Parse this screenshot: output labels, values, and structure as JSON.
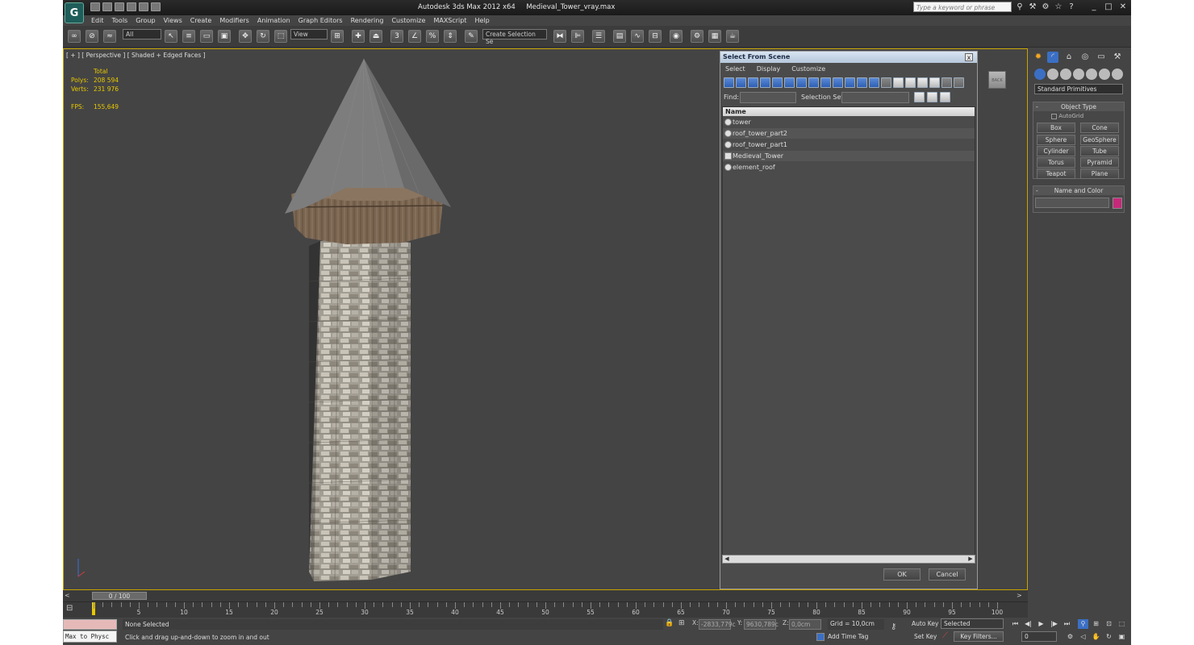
{
  "title_bar": {
    "app_title": "Autodesk 3ds Max  2012 x64",
    "file_name": "Medieval_Tower_vray.max",
    "search_placeholder": "Type a keyword or phrase"
  },
  "menu": [
    "Edit",
    "Tools",
    "Group",
    "Views",
    "Create",
    "Modifiers",
    "Animation",
    "Graph Editors",
    "Rendering",
    "Customize",
    "MAXScript",
    "Help"
  ],
  "toolbar": {
    "selection_filter": "All",
    "reference_coord": "View",
    "named_selection_set": "Create Selection Se",
    "snap_labels": [
      "3",
      "%"
    ]
  },
  "viewport": {
    "label": "[ + ] [ Perspective ] [ Shaded + Edged Faces ]",
    "stats_header": "Total",
    "polys_label": "Polys:",
    "polys_value": "208 594",
    "verts_label": "Verts:",
    "verts_value": "231 976",
    "fps_label": "FPS:",
    "fps_value": "155,649",
    "viewcube_label": "BACK"
  },
  "dialog": {
    "title": "Select From Scene",
    "close": "x",
    "menu": [
      "Select",
      "Display",
      "Customize"
    ],
    "find_label": "Find:",
    "selection_set_label": "Selection Set:",
    "column_name": "Name",
    "objects": [
      "tower",
      "roof_tower_part2",
      "roof_tower_part1",
      "Medieval_Tower",
      "element_roof"
    ],
    "ok": "OK",
    "cancel": "Cancel"
  },
  "command_panel": {
    "category": "Standard Primitives",
    "object_type_header": "Object Type",
    "autogrid": "AutoGrid",
    "primitives": [
      "Box",
      "Cone",
      "Sphere",
      "GeoSphere",
      "Cylinder",
      "Tube",
      "Torus",
      "Pyramid",
      "Teapot",
      "Plane"
    ],
    "name_color_header": "Name and Color",
    "collapse_mark": "-",
    "object_color": "#c8287a"
  },
  "timeline": {
    "slider_label": "0 / 100",
    "ticks": [
      "5",
      "10",
      "15",
      "20",
      "25",
      "30",
      "35",
      "40",
      "45",
      "50",
      "55",
      "60",
      "65",
      "70",
      "75",
      "80",
      "85",
      "90",
      "95",
      "100"
    ]
  },
  "status": {
    "maxscript": "Max to Physc",
    "selection_status": "None Selected",
    "prompt": "Click and drag up-and-down to zoom in and out",
    "x_label": "X:",
    "x_value": "-2833,779c",
    "y_label": "Y:",
    "y_value": "9630,789c",
    "z_label": "Z:",
    "z_value": "0,0cm",
    "grid": "Grid = 10,0cm",
    "add_time_tag": "Add Time Tag",
    "auto_key": "Auto Key",
    "set_key": "Set Key",
    "key_mode": "Selected",
    "key_filters": "Key Filters...",
    "current_frame": "0"
  }
}
